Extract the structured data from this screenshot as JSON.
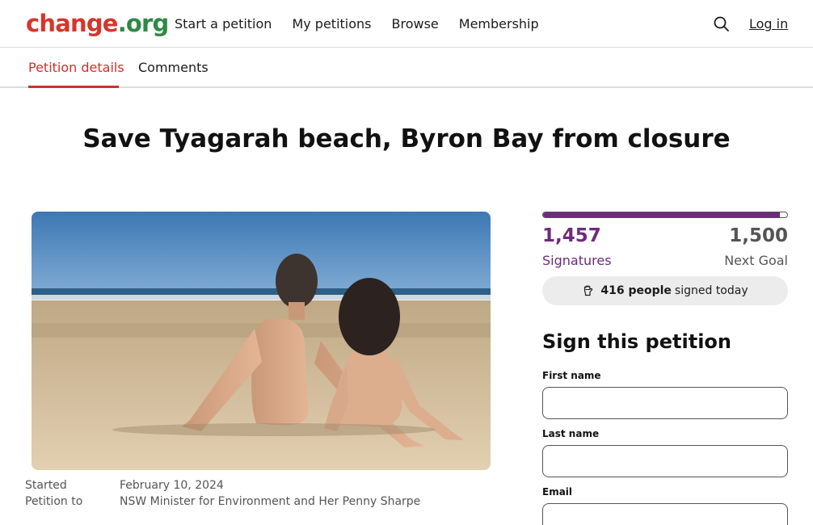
{
  "header": {
    "logo_part1": "change",
    "logo_part2": ".org",
    "nav": [
      "Start a petition",
      "My petitions",
      "Browse",
      "Membership"
    ],
    "login_label": "Log in",
    "search_icon": "search-icon"
  },
  "tabs": {
    "active_label": "Petition details",
    "comments_label": "Comments"
  },
  "petition": {
    "title": "Save Tyagarah beach, Byron Bay from closure",
    "started_label": "Started",
    "started_value": "February 10, 2024",
    "petition_to_label": "Petition to",
    "petition_to_value": "NSW Minister for Environment and Her Penny Sharpe"
  },
  "progress": {
    "signatures": "1,457",
    "goal": "1,500",
    "signatures_label": "Signatures",
    "goal_label": "Next Goal",
    "fraction": 0.971,
    "today_count": "416 people",
    "today_text": "signed today"
  },
  "form": {
    "heading": "Sign this petition",
    "first_name_label": "First name",
    "last_name_label": "Last name",
    "email_label": "Email",
    "first_name_value": "",
    "last_name_value": "",
    "email_value": ""
  },
  "colors": {
    "brand_red": "#c8342c",
    "accent_purple": "#6e2a7c"
  }
}
